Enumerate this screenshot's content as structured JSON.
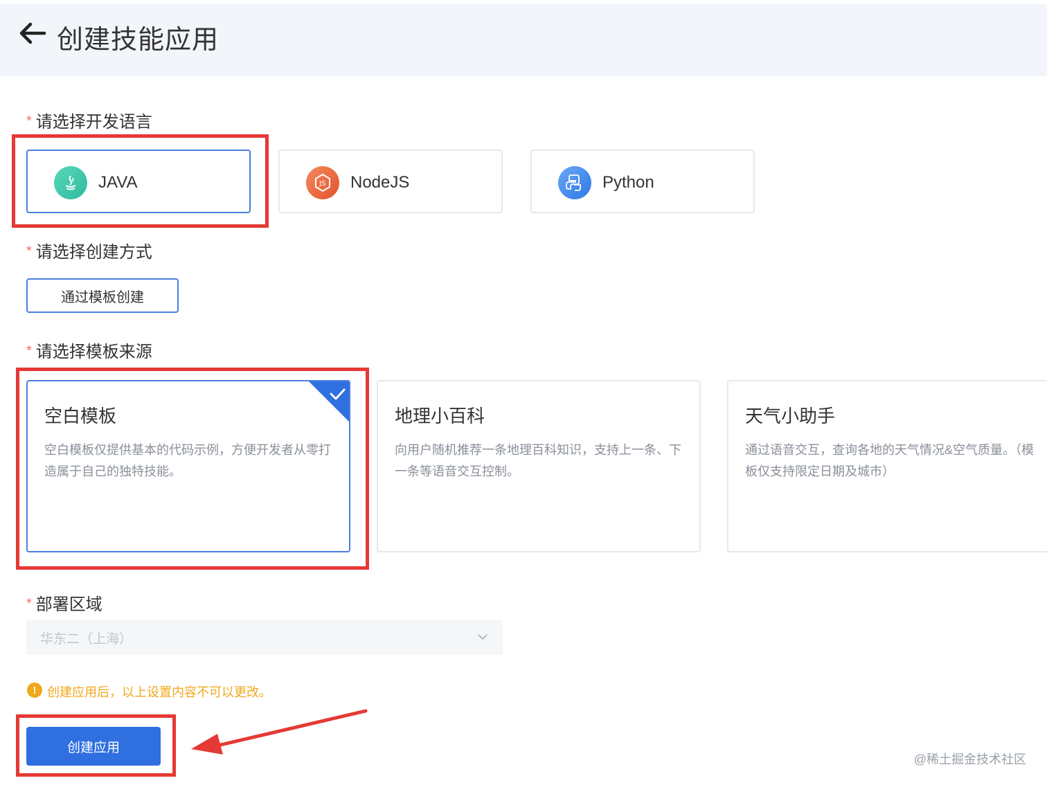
{
  "header": {
    "title": "创建技能应用",
    "back_icon": "arrow-left-icon"
  },
  "form": {
    "required_mark": "*",
    "language": {
      "label": "请选择开发语言",
      "options": [
        {
          "name": "JAVA",
          "icon": "java-icon",
          "color": "#36c7a8",
          "selected": true
        },
        {
          "name": "NodeJS",
          "icon": "nodejs-icon",
          "color": "#f06a3c",
          "selected": false
        },
        {
          "name": "Python",
          "icon": "python-icon",
          "color": "#3f8ef0",
          "selected": false
        }
      ]
    },
    "method": {
      "label": "请选择创建方式",
      "button": "通过模板创建"
    },
    "template": {
      "label": "请选择模板来源",
      "cards": [
        {
          "title": "空白模板",
          "desc": "空白模板仅提供基本的代码示例，方便开发者从零打造属于自己的独特技能。",
          "selected": true
        },
        {
          "title": "地理小百科",
          "desc": "向用户随机推荐一条地理百科知识，支持上一条、下一条等语音交互控制。",
          "selected": false
        },
        {
          "title": "天气小助手",
          "desc": "通过语音交互，查询各地的天气情况&空气质量。（模板仅支持限定日期及城市）",
          "selected": false
        }
      ]
    },
    "region": {
      "label": "部署区域",
      "value": "华东二（上海）"
    },
    "notice": "创建应用后，以上设置内容不可以更改。",
    "submit": "创建应用"
  },
  "watermark": "@稀土掘金技术社区",
  "colors": {
    "primary": "#2f6fe0",
    "accent_border": "#4a7de0",
    "warning": "#f0a81c",
    "required": "#f56c6c",
    "annotation": "#e53935"
  }
}
